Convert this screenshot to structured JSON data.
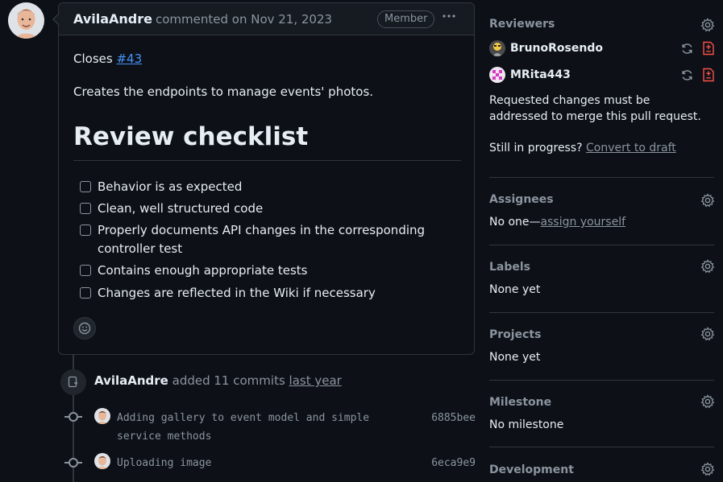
{
  "comment": {
    "author": "AvilaAndre",
    "meta": "commented on Nov 21, 2023",
    "badge": "Member",
    "closes_prefix": "Closes",
    "closes_issue": "#43",
    "description": "Creates the endpoints to manage events' photos.",
    "heading": "Review checklist",
    "checklist": [
      "Behavior is as expected",
      "Clean, well structured code",
      "Properly documents API changes in the corresponding controller test",
      "Contains enough appropriate tests",
      "Changes are reflected in the Wiki if necessary"
    ]
  },
  "timeline": {
    "event_author": "AvilaAndre",
    "event_text": "added 11 commits",
    "event_when": "last year",
    "commits": [
      {
        "message": "Adding gallery to event model and simple service methods",
        "sha": "6885bee"
      },
      {
        "message": "Uploading image",
        "sha": "6eca9e9"
      }
    ]
  },
  "sidebar": {
    "reviewers": {
      "title": "Reviewers",
      "people": [
        {
          "name": "BrunoRosendo"
        },
        {
          "name": "MRita443"
        }
      ],
      "notice": "Requested changes must be addressed to merge this pull request.",
      "progress_text": "Still in progress?",
      "progress_link": "Convert to draft"
    },
    "assignees": {
      "title": "Assignees",
      "value_prefix": "No one—",
      "value_link": "assign yourself"
    },
    "labels": {
      "title": "Labels",
      "value": "None yet"
    },
    "projects": {
      "title": "Projects",
      "value": "None yet"
    },
    "milestone": {
      "title": "Milestone",
      "value": "No milestone"
    },
    "development": {
      "title": "Development"
    }
  },
  "colors": {
    "background": "#0d1117",
    "header_bg": "#161b22",
    "border": "#30363d",
    "link_blue": "#4493f8",
    "muted": "#8b949e",
    "danger": "#f85149"
  },
  "icons": [
    "gear-icon",
    "sync-icon",
    "diff-requested-icon",
    "smiley-icon",
    "kebab-icon",
    "repo-push-icon",
    "git-commit-icon"
  ]
}
